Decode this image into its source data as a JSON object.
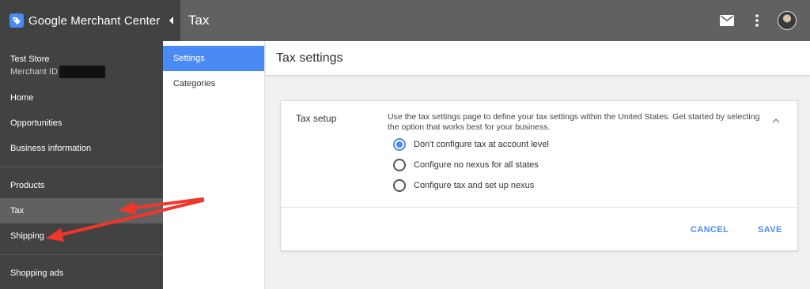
{
  "app": {
    "brand_name": "Google Merchant Center",
    "logo_icon": "merchant-center-tag-icon"
  },
  "sidebar": {
    "store_name": "Test Store",
    "merchant_id_label": "Merchant ID",
    "items": [
      {
        "label": "Home"
      },
      {
        "label": "Opportunities"
      },
      {
        "label": "Business information"
      },
      {
        "label": "Products"
      },
      {
        "label": "Tax",
        "active": true
      },
      {
        "label": "Shipping"
      },
      {
        "label": "Shopping ads"
      }
    ]
  },
  "header": {
    "title": "Tax",
    "icons": [
      "mail-icon",
      "more-vert-icon",
      "avatar"
    ]
  },
  "subnav": {
    "items": [
      {
        "label": "Settings",
        "active": true
      },
      {
        "label": "Categories"
      }
    ]
  },
  "content": {
    "title": "Tax settings",
    "card": {
      "label": "Tax setup",
      "description": "Use the tax settings page to define your tax settings within the United States. Get started by selecting the option that works best for your business.",
      "options": [
        {
          "label": "Don't configure tax at account level",
          "selected": true
        },
        {
          "label": "Configure no nexus for all states",
          "selected": false
        },
        {
          "label": "Configure tax and set up nexus",
          "selected": false
        }
      ],
      "cancel_label": "CANCEL",
      "save_label": "SAVE"
    }
  },
  "colors": {
    "accent": "#4a8af4",
    "sidebar_bg": "#424242",
    "topbar_bg": "#616161",
    "annotation": "#f2352b"
  }
}
